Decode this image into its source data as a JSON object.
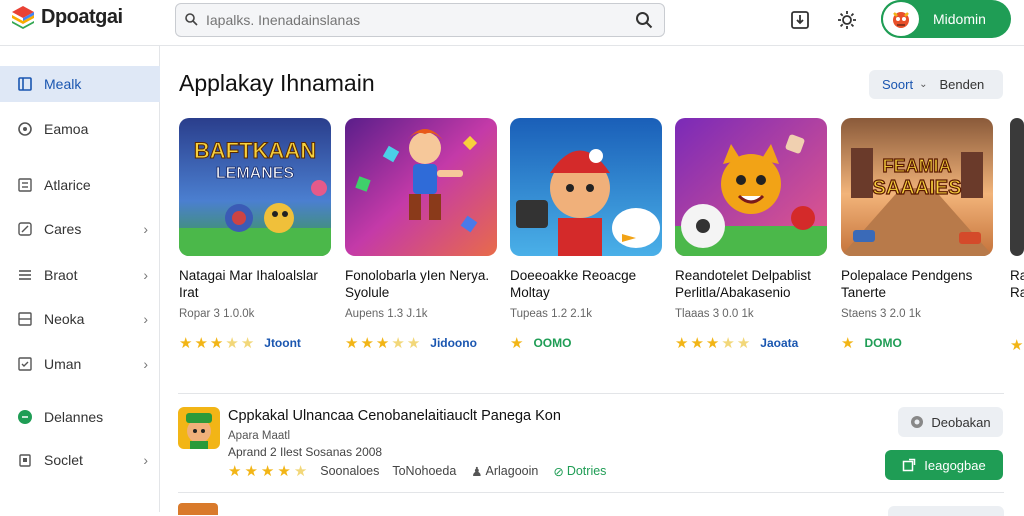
{
  "app": {
    "name": "Dpoatgai"
  },
  "search": {
    "placeholder": "Iapalks. Inenadainslanas"
  },
  "account": {
    "name": "Midomin"
  },
  "sidebar": {
    "items": [
      {
        "label": "Mealk",
        "icon": "store-icon",
        "active": true,
        "chevron": false
      },
      {
        "label": "Eamoa",
        "icon": "gamepad-icon",
        "active": false,
        "chevron": false
      },
      {
        "label": "Atlarice",
        "icon": "apps-grid-icon",
        "active": false,
        "chevron": false
      },
      {
        "label": "Cares",
        "icon": "edit-icon",
        "active": false,
        "chevron": true
      },
      {
        "label": "Braot",
        "icon": "list-icon",
        "active": false,
        "chevron": true
      },
      {
        "label": "Neoka",
        "icon": "window-icon",
        "active": false,
        "chevron": true
      },
      {
        "label": "Uman",
        "icon": "checkbox-icon",
        "active": false,
        "chevron": true
      },
      {
        "label": "Delannes",
        "icon": "chat-icon",
        "active": false,
        "chevron": false
      },
      {
        "label": "Soclet",
        "icon": "trash-icon",
        "active": false,
        "chevron": true
      }
    ]
  },
  "main": {
    "title": "Applakay Ihnamain",
    "sort": {
      "label": "Soort",
      "value": "Benden"
    }
  },
  "cards": [
    {
      "thumb_text": "BAFTKAAN\nLEMANES",
      "title": "Natagai Mar Ihaloalslar Irat",
      "meta": "Ropar 3 1.0.0k",
      "stars": [
        1,
        1,
        1,
        0.5,
        0.5
      ],
      "rating_label": "Jtoont",
      "rating_color": "#1a56b0"
    },
    {
      "thumb_text": "",
      "title": "Fonolobarla yIen Nerya. Syolule",
      "meta": "Aupens 1.3 J.1k",
      "stars": [
        1,
        1,
        1,
        0.5,
        0.5
      ],
      "rating_label": "Jidoono",
      "rating_color": "#1a56b0"
    },
    {
      "thumb_text": "",
      "title": "Doeeoakke Reoacge Moltay",
      "meta": "Tupeas 1.2 2.1k",
      "stars": [
        1
      ],
      "rating_label": "OOMO",
      "rating_color": "#1f9d55"
    },
    {
      "thumb_text": "",
      "title": "Reandotelet Delpablist Perlitla/Abakasenio",
      "meta": "Tlaaas 3 0.0 1k",
      "stars": [
        1,
        1,
        1,
        0.5,
        0.5
      ],
      "rating_label": "Jaoata",
      "rating_color": "#1a56b0"
    },
    {
      "thumb_text": "FEAMIA\nSAAAIES",
      "title": "Polepalace Pendgens Tanerte",
      "meta": "Staens 3 2.0 1k",
      "stars": [
        1
      ],
      "rating_label": "DOMO",
      "rating_color": "#1f9d55"
    },
    {
      "thumb_text": "",
      "title": "Ra Ra",
      "meta": "",
      "stars": [
        1
      ],
      "rating_label": "",
      "rating_color": "#1a56b0"
    }
  ],
  "list_row": {
    "title": "Cppkakal Ulnancaa Cenobanelaitiauclt Panega Kon",
    "sub": "Apara Maatl",
    "sub2": "Aprand 2 Ilest Sosanas 2008",
    "meta": [
      {
        "type": "stars",
        "value": "4.5"
      },
      {
        "type": "text",
        "value": "Soonaloes"
      },
      {
        "type": "text",
        "value": "ToNohoeda"
      },
      {
        "type": "user",
        "value": "Arlagooin"
      },
      {
        "type": "green",
        "value": "Dotries"
      }
    ],
    "btn_secondary": "Deobakan",
    "btn_primary": "Ieagogbae"
  }
}
